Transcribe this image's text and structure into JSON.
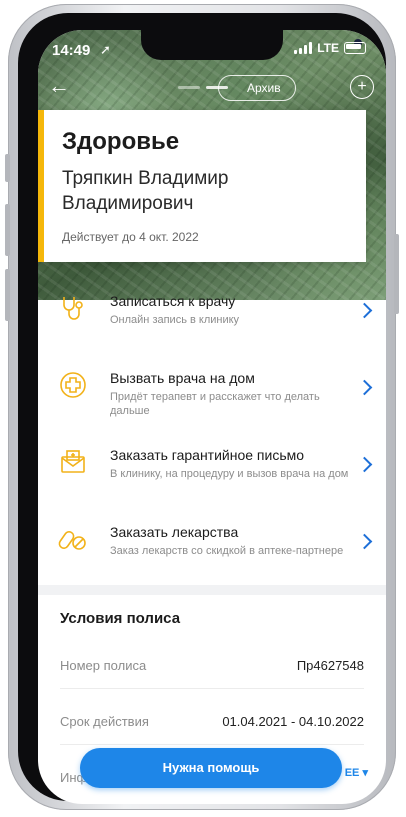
{
  "status_bar": {
    "time": "14:49",
    "network": "LTE"
  },
  "header": {
    "archive_label": "Архив"
  },
  "card": {
    "title": "Здоровье",
    "holder_name": "Тряпкин Владимир Владимирович",
    "valid_until": "Действует до 4 окт. 2022",
    "accent_color": "#f5b70a"
  },
  "services": [
    {
      "title": "Записаться к врачу",
      "subtitle": "Онлайн запись в клинику",
      "icon": "stethoscope-icon"
    },
    {
      "title": "Вызвать врача на дом",
      "subtitle": "Придёт терапевт и расскажет что делать дальше",
      "icon": "medical-cross-icon"
    },
    {
      "title": "Заказать гарантийное письмо",
      "subtitle": "В клинику, на процедуру и вызов врача на дом",
      "icon": "letter-icon"
    },
    {
      "title": "Заказать лекарства",
      "subtitle": "Заказ лекарств со скидкой в аптеке-партнере",
      "icon": "pills-icon"
    }
  ],
  "policy": {
    "section_title": "Условия полиса",
    "number_label": "Номер полиса",
    "number_value": "Пр4627548",
    "term_label": "Срок действия",
    "term_value": "01.04.2021 - 04.10.2022",
    "info_label": "Инфо",
    "more_label": "ЕЕ"
  },
  "help_button": {
    "label": "Нужна помощь",
    "color": "#1e86e8"
  }
}
